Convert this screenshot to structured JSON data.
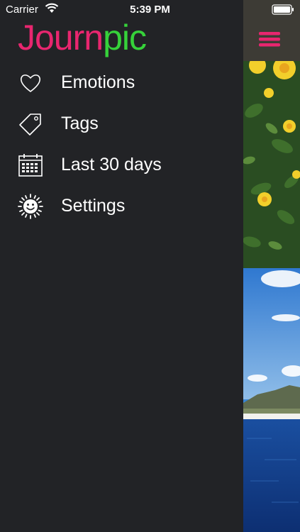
{
  "status_bar": {
    "carrier": "Carrier",
    "time": "5:39 PM",
    "wifi_icon": "wifi-icon",
    "battery_icon": "battery-icon"
  },
  "menu": {
    "logo": {
      "part1": "Journ",
      "part2": "pic",
      "color1": "#e8266f",
      "color2": "#36d23a"
    },
    "items": [
      {
        "label": "Emotions",
        "icon": "heart-icon"
      },
      {
        "label": "Tags",
        "icon": "tag-icon"
      },
      {
        "label": "Last 30 days",
        "icon": "calendar-icon"
      },
      {
        "label": "Settings",
        "icon": "sun-face-icon"
      }
    ]
  },
  "main": {
    "menu_button_icon": "hamburger-icon",
    "accent_color": "#e8266f",
    "photos": [
      "yellow-roses-photo",
      "ocean-mountain-photo"
    ]
  }
}
